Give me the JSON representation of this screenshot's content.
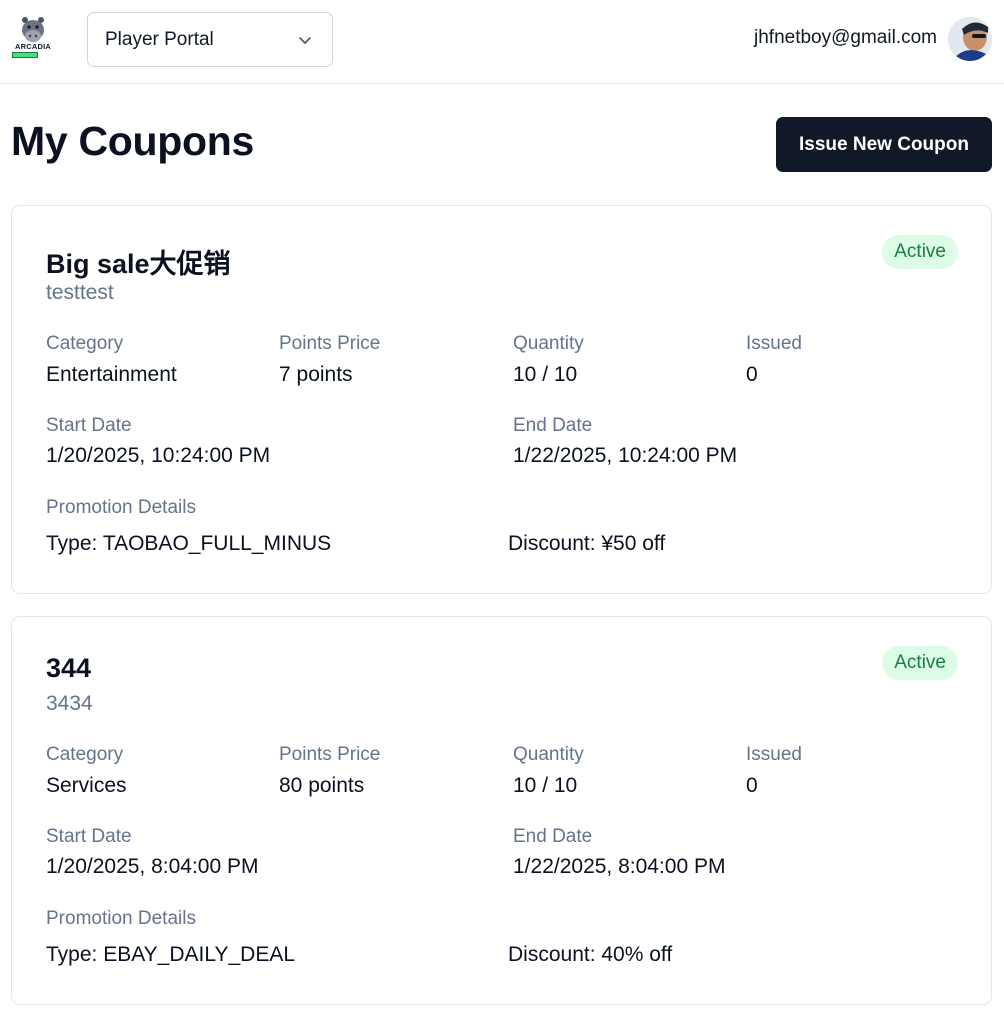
{
  "header": {
    "logo_text": "ARCADIA",
    "portal_select_value": "Player Portal",
    "user_email": "jhfnetboy@gmail.com"
  },
  "page": {
    "title": "My Coupons",
    "issue_button_label": "Issue New Coupon"
  },
  "labels": {
    "category": "Category",
    "points_price": "Points Price",
    "quantity": "Quantity",
    "issued": "Issued",
    "start_date": "Start Date",
    "end_date": "End Date",
    "promotion_details": "Promotion Details"
  },
  "coupons": [
    {
      "title": "Big sale大促销",
      "description": "testtest",
      "status": "Active",
      "category": "Entertainment",
      "points_price": "7 points",
      "quantity": "10 / 10",
      "issued": "0",
      "start_date": "1/20/2025, 10:24:00 PM",
      "end_date": "1/22/2025, 10:24:00 PM",
      "promo_type": "Type: TAOBAO_FULL_MINUS",
      "promo_discount": "Discount: ¥50 off"
    },
    {
      "title": "344",
      "description": "3434",
      "status": "Active",
      "category": "Services",
      "points_price": "80 points",
      "quantity": "10 / 10",
      "issued": "0",
      "start_date": "1/20/2025, 8:04:00 PM",
      "end_date": "1/22/2025, 8:04:00 PM",
      "promo_type": "Type: EBAY_DAILY_DEAL",
      "promo_discount": "Discount: 40% off"
    }
  ],
  "colors": {
    "primary_button": "#111827",
    "active_badge_bg": "#dcfce7",
    "active_badge_text": "#15803d",
    "muted_text": "#64748b"
  },
  "icons": {
    "logo": "hippo-logo-icon",
    "select_chevron": "chevron-down-icon",
    "avatar": "user-avatar"
  }
}
